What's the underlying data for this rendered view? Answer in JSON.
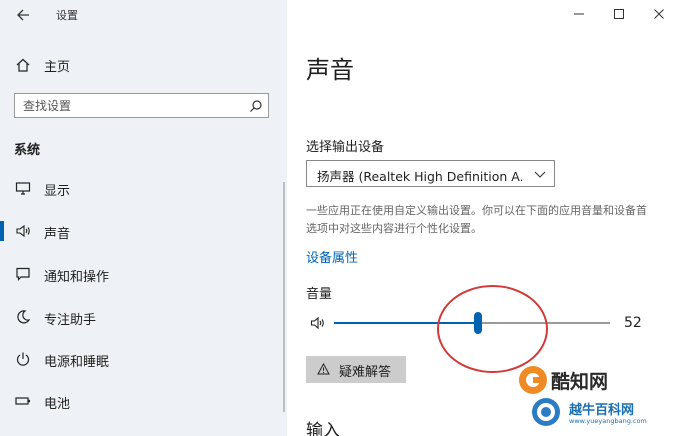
{
  "window": {
    "title": "设置",
    "back_icon": "arrow-left-icon",
    "controls": [
      "minimize-icon",
      "maximize-icon",
      "close-icon"
    ]
  },
  "sidebar": {
    "home": {
      "label": "主页",
      "icon": "home-icon"
    },
    "search": {
      "placeholder": "查找设置",
      "value": "",
      "icon": "search-icon"
    },
    "section_title": "系统",
    "items": [
      {
        "label": "显示",
        "icon": "monitor-icon",
        "active": false
      },
      {
        "label": "声音",
        "icon": "speaker-icon",
        "active": true
      },
      {
        "label": "通知和操作",
        "icon": "message-icon",
        "active": false
      },
      {
        "label": "专注助手",
        "icon": "moon-icon",
        "active": false
      },
      {
        "label": "电源和睡眠",
        "icon": "power-icon",
        "active": false
      },
      {
        "label": "电池",
        "icon": "battery-icon",
        "active": false
      }
    ]
  },
  "main": {
    "title": "声音",
    "output_label": "选择输出设备",
    "output_device": "扬声器 (Realtek High Definition A...",
    "description": "一些应用正在使用自定义输出设置。你可以在下面的应用音量和设备首选项中对这些内容进行个性化设置。",
    "device_properties_link": "设备属性",
    "volume_label": "音量",
    "volume_value": 52,
    "volume_value_text": "52",
    "troubleshoot_label": "疑难解答",
    "input_heading": "输入"
  },
  "watermark": {
    "title": "酷知网",
    "subtitle": "越牛百科网",
    "url": "www.yueyangbang.com"
  },
  "colors": {
    "accent": "#0063b1",
    "sidebar_bg": "#eef1f5",
    "link": "#0066b4",
    "annotation": "#d13a3a",
    "button_bg": "#cccccc"
  }
}
